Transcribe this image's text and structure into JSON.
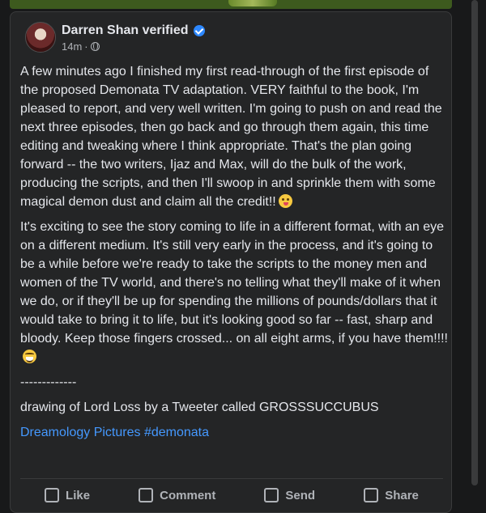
{
  "post": {
    "author": "Darren Shan verified",
    "time": "14m",
    "dot": "·",
    "paragraph1": "A few minutes ago I finished my first read-through of the first episode of the proposed Demonata TV adaptation. VERY faithful to the book, I'm pleased to report, and very well written. I'm going to push on and read the next three episodes, then go back and go through them again, this time editing and tweaking where I think appropriate. That's the plan going forward -- the two writers, Ijaz and Max, will do the bulk of the work, producing the scripts, and then I'll swoop in and sprinkle them with some magical demon dust and claim all the credit!!",
    "paragraph2": "It's exciting to see the story coming to life in a different format, with an eye on a different medium. It's still very early in the process, and it's going to be a while before we're ready to take the scripts to the money men and women of the TV world, and there's no telling what they'll make of it when we do, or if they'll be up for spending the millions of pounds/dollars that it would take to bring it to life, but it's looking good so far -- fast, sharp and bloody. Keep those fingers crossed... on all eight arms, if you have them!!!!",
    "divider": "-------------",
    "credit": "drawing of Lord Loss by a Tweeter called GROSSSUCCUBUS",
    "tag1": "Dreamology Pictures",
    "tag2": "#demonata"
  },
  "actions": {
    "like": "Like",
    "comment": "Comment",
    "send": "Send",
    "share": "Share"
  },
  "icons": {
    "verified": "verified-badge-icon",
    "privacy": "globe-icon",
    "emoji1": "winking-tongue-emoji",
    "emoji2": "laughing-tears-emoji"
  },
  "colors": {
    "background": "#18191a",
    "card": "#242526",
    "link": "#4599ff",
    "verified": "#2d88ff"
  }
}
